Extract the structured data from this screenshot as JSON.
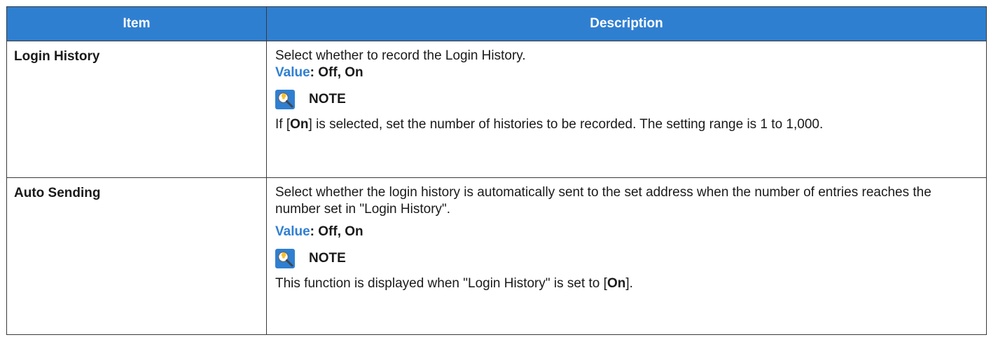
{
  "table": {
    "headers": {
      "item": "Item",
      "description": "Description"
    },
    "rows": [
      {
        "item": "Login History",
        "description": "Select whether to record the Login History.",
        "value_label": "Value",
        "value_sep": ": ",
        "value_options": "Off, On",
        "note_title": "NOTE",
        "note_pre": "If [",
        "note_bold": "On",
        "note_post": "] is selected, set the number of histories to be recorded. The setting range is 1 to 1,000."
      },
      {
        "item": "Auto Sending",
        "description": "Select whether the login history is automatically sent to the set address when the number of entries reaches the number set in \"Login History\".",
        "value_label": "Value",
        "value_sep": ": ",
        "value_options": "Off, On",
        "note_title": "NOTE",
        "note_pre": "This function is displayed when \"Login History\" is set to [",
        "note_bold": "On",
        "note_post": "]."
      }
    ]
  },
  "colors": {
    "header_bg": "#2f7fd1",
    "header_text": "#ffffff",
    "value_label": "#2f7fd1",
    "border": "#3a3a3a"
  },
  "icons": {
    "note": "note-magnifier-icon"
  }
}
